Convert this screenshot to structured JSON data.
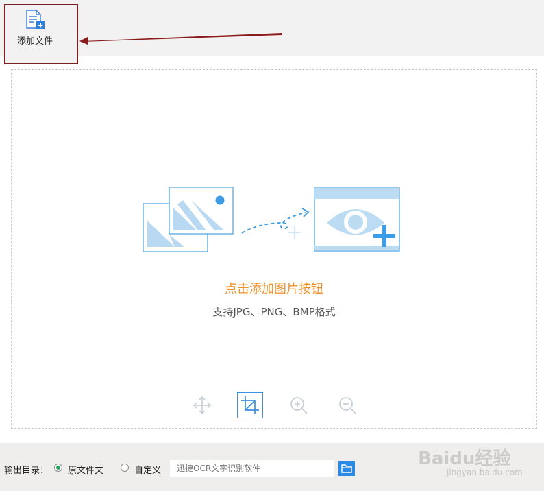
{
  "toolbar": {
    "add_file_label": "添加文件"
  },
  "drop_zone": {
    "title": "点击添加图片按钮",
    "subtitle": "支持JPG、PNG、BMP格式",
    "accent_color": "#f0902a"
  },
  "tools": {
    "move": "move-icon",
    "crop": "crop-icon",
    "zoom_in": "zoom-in-icon",
    "zoom_out": "zoom-out-icon"
  },
  "output": {
    "label": "输出目录：",
    "option_original": "原文件夹",
    "option_custom": "自定义",
    "selected": "原文件夹",
    "path_placeholder": "迅捷OCR文字识别软件"
  },
  "watermark": {
    "logo": "Baidu经验",
    "url": "jingyan.baidu.com"
  }
}
